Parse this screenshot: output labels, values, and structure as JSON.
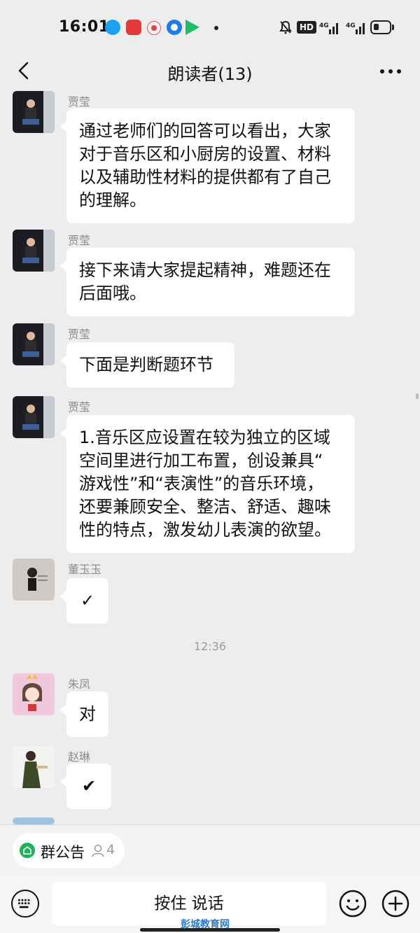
{
  "status": {
    "time": "16:01",
    "hd_label": "HD",
    "network_1": "4G",
    "network_2": "4G"
  },
  "header": {
    "title": "朗读者(13)"
  },
  "messages": [
    {
      "sender": "贾莹",
      "text": "通过老师们的回答可以看出，大家\n对于音乐区和小厨房的设置、材料\n以及辅助性材料的提供都有了自己\n的理解。"
    },
    {
      "sender": "贾莹",
      "text": "接下来请大家提起精神，难题还在\n后面哦。"
    },
    {
      "sender": "贾莹",
      "text": "下面是判断题环节"
    },
    {
      "sender": "贾莹",
      "text": "1.音乐区应设置在较为独立的区域\n空间里进行加工布置，创设兼具“\n游戏性”和“表演性”的音乐环境，\n还要兼顾安全、整洁、舒适、趣味\n性的特点，激发幼儿表演的欲望。"
    },
    {
      "sender": "董玉玉",
      "text": "✓"
    },
    {
      "sender": "朱凤",
      "text": "对"
    },
    {
      "sender": "赵琳",
      "text": "✔"
    }
  ],
  "timestamp": "12:36",
  "notice": {
    "label": "群公告",
    "count": "4"
  },
  "input": {
    "hold_to_talk": "按住 说话"
  },
  "watermark": "彭城教育网",
  "colors": {
    "background": "#ededed",
    "bubble": "#ffffff",
    "accent_green": "#1fb25a"
  }
}
